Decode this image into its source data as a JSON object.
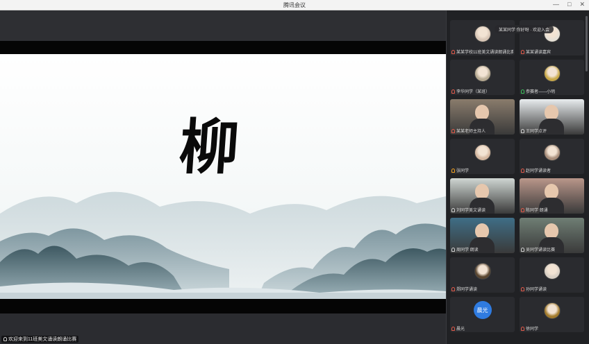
{
  "window": {
    "title": "腾讯会议",
    "controls": [
      "—",
      "□",
      "✕"
    ]
  },
  "slide": {
    "character": "柳"
  },
  "presenter": {
    "name": "欢迎来到11班美文诵读朗诵比赛"
  },
  "ticker": {
    "text": "某某同学 你好呀 · 欢迎入会"
  },
  "participants": [
    {
      "label": "某某学校11班美文诵读朗诵比赛",
      "kind": "avatar",
      "tone": "#d8c6b6",
      "mic": "red"
    },
    {
      "label": "某某诵读嘉宾",
      "kind": "avatar",
      "tone": "#e6e0d6",
      "mic": "red"
    },
    {
      "label": "李华同学（某班）",
      "kind": "avatar",
      "tone": "#b7aa92",
      "mic": "red"
    },
    {
      "label": "参赛者——小明",
      "kind": "avatar",
      "tone": "#c9a94a",
      "mic": "green"
    },
    {
      "label": "某某老师主持人",
      "kind": "video",
      "tone": "#8a7c6c",
      "mic": "red"
    },
    {
      "label": "王同学点评",
      "kind": "video",
      "tone": "#e8ecee",
      "mic": "normal"
    },
    {
      "label": "张同学",
      "kind": "avatar",
      "tone": "#d4b7a0",
      "mic": "orange"
    },
    {
      "label": "赵同学诵读者",
      "kind": "avatar",
      "tone": "#a98f7c",
      "mic": "red"
    },
    {
      "label": "刘同学美文诵读",
      "kind": "video",
      "tone": "#cfd6d2",
      "mic": "normal"
    },
    {
      "label": "陈同学 朗诵",
      "kind": "video",
      "tone": "#b9968a",
      "mic": "red"
    },
    {
      "label": "周同学 朗读",
      "kind": "video",
      "tone": "#3f6e86",
      "mic": "normal"
    },
    {
      "label": "吴同学诵读比赛",
      "kind": "video",
      "tone": "#6f7e74",
      "mic": "normal"
    },
    {
      "label": "郑同学诵读",
      "kind": "avatar",
      "tone": "#5a4630",
      "mic": "red"
    },
    {
      "label": "孙同学诵读",
      "kind": "avatar",
      "tone": "#d8cfc4",
      "mic": "red"
    },
    {
      "label": "晨光",
      "kind": "circle",
      "circle_text": "晨光",
      "tone": "#2f7be0",
      "mic": "red"
    },
    {
      "label": "徐同学",
      "kind": "avatar",
      "tone": "#a37b2c",
      "mic": "red"
    }
  ]
}
